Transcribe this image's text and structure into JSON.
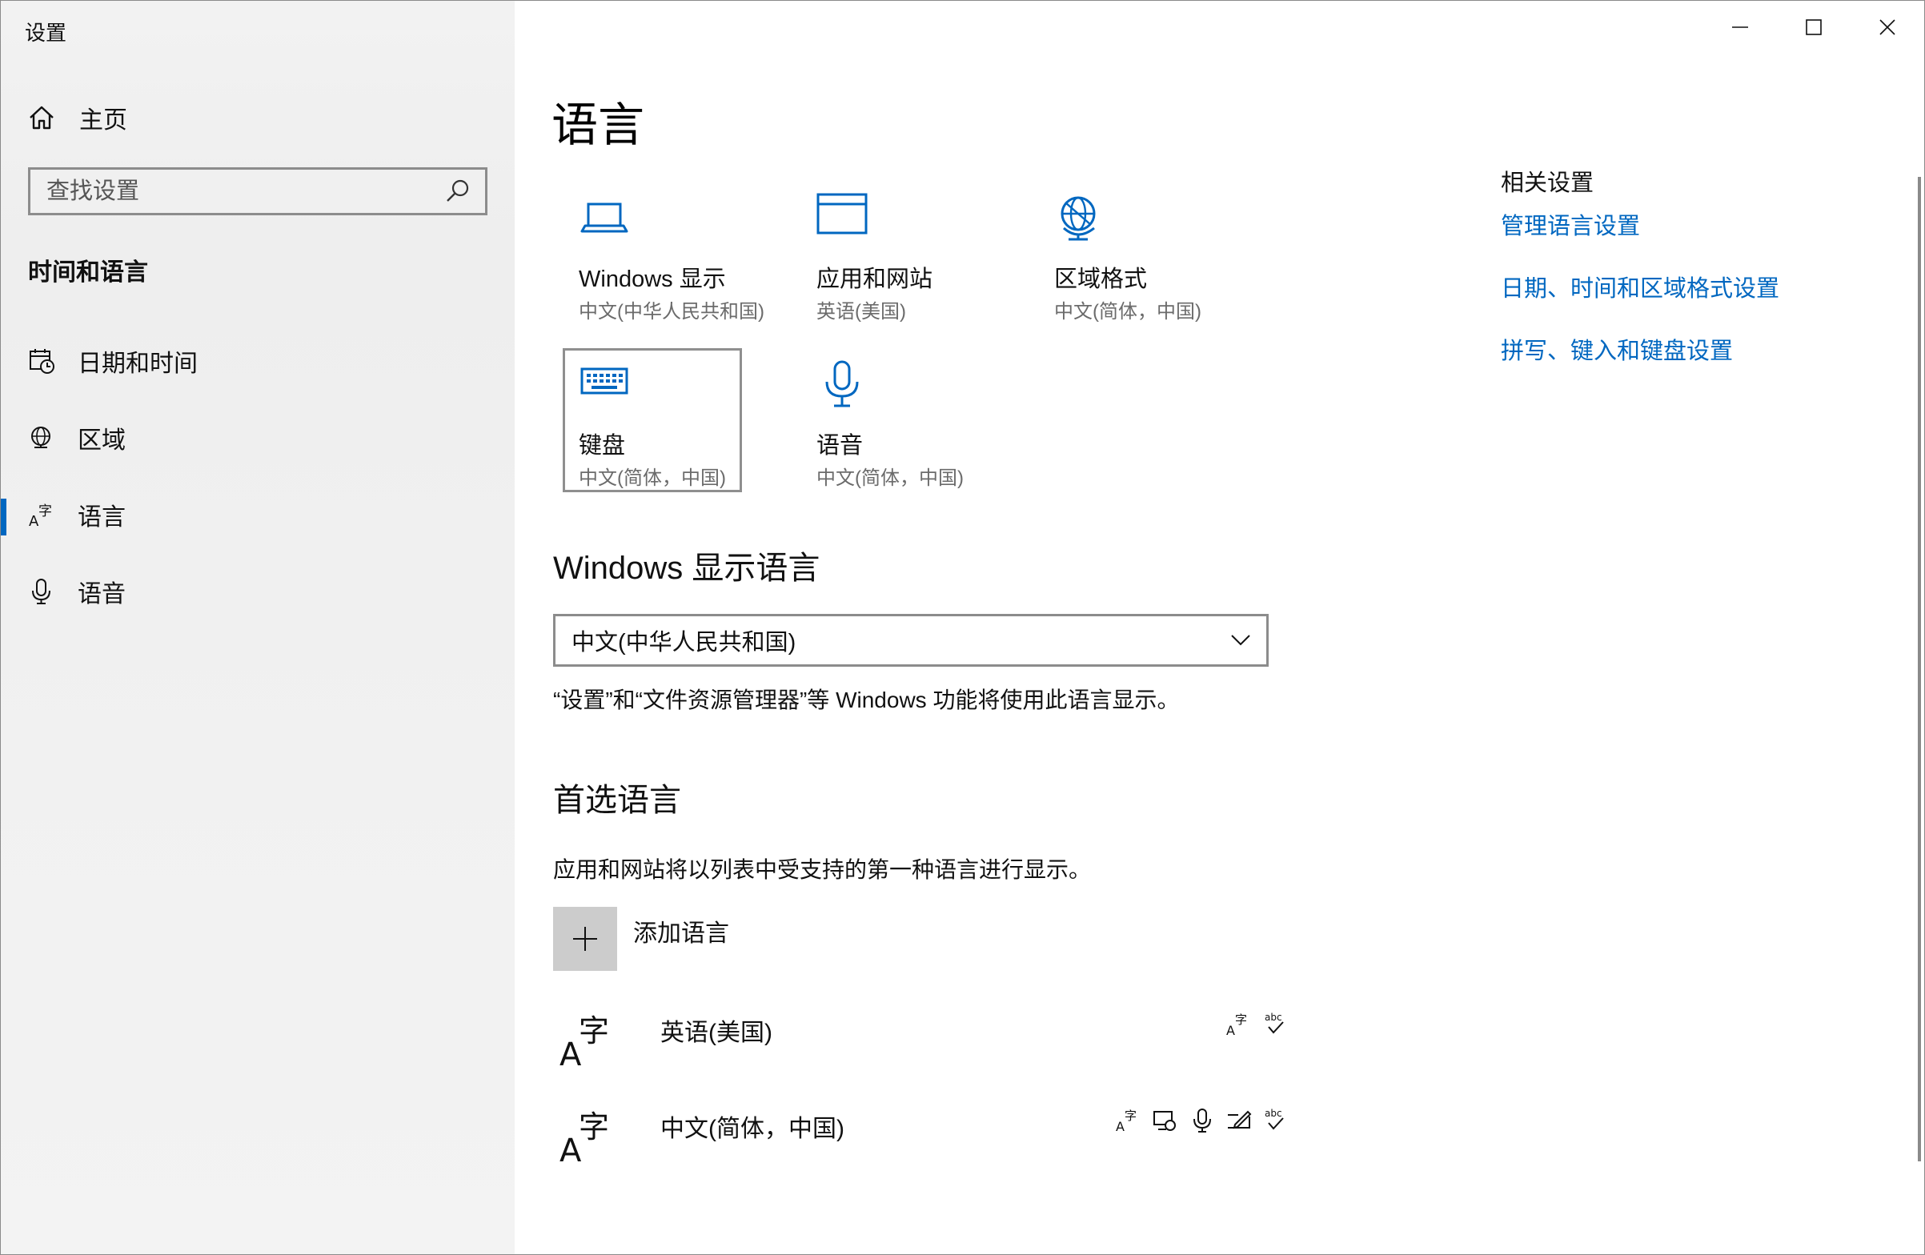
{
  "window": {
    "title": "设置"
  },
  "sidebar": {
    "home_label": "主页",
    "search_placeholder": "查找设置",
    "section_title": "时间和语言",
    "items": [
      {
        "label": "日期和时间",
        "icon": "date-time-icon",
        "active": false
      },
      {
        "label": "区域",
        "icon": "region-globe-icon",
        "active": false
      },
      {
        "label": "语言",
        "icon": "language-icon",
        "active": true
      },
      {
        "label": "语音",
        "icon": "microphone-icon",
        "active": false
      }
    ]
  },
  "main": {
    "title": "语言",
    "tiles": [
      {
        "name": "Windows 显示",
        "sub": "中文(中华人民共和国)",
        "icon": "laptop-icon"
      },
      {
        "name": "应用和网站",
        "sub": "英语(美国)",
        "icon": "window-icon"
      },
      {
        "name": "区域格式",
        "sub": "中文(简体，中国)",
        "icon": "globe-icon"
      },
      {
        "name": "键盘",
        "sub": "中文(简体，中国)",
        "icon": "keyboard-icon",
        "selected": true
      },
      {
        "name": "语音",
        "sub": "中文(简体，中国)",
        "icon": "microphone-icon"
      }
    ],
    "display_language": {
      "heading": "Windows 显示语言",
      "selected": "中文(中华人民共和国)",
      "description": "“设置”和“文件资源管理器”等 Windows 功能将使用此语言显示。"
    },
    "preferred": {
      "heading": "首选语言",
      "description": "应用和网站将以列表中受支持的第一种语言进行显示。",
      "add_label": "添加语言",
      "languages": [
        {
          "name": "英语(美国)",
          "features": [
            "display-language-icon",
            "spell-check-icon"
          ]
        },
        {
          "name": "中文(简体，中国)",
          "features": [
            "display-language-icon",
            "text-to-speech-icon",
            "speech-recognition-icon",
            "handwriting-icon",
            "spell-check-icon"
          ]
        }
      ]
    }
  },
  "related": {
    "heading": "相关设置",
    "links": [
      "管理语言设置",
      "日期、时间和区域格式设置",
      "拼写、键入和键盘设置"
    ]
  },
  "colors": {
    "accent": "#0067c0",
    "sidebar_bg": "#f2f2f2",
    "secondary_text": "#6b6b6b"
  }
}
